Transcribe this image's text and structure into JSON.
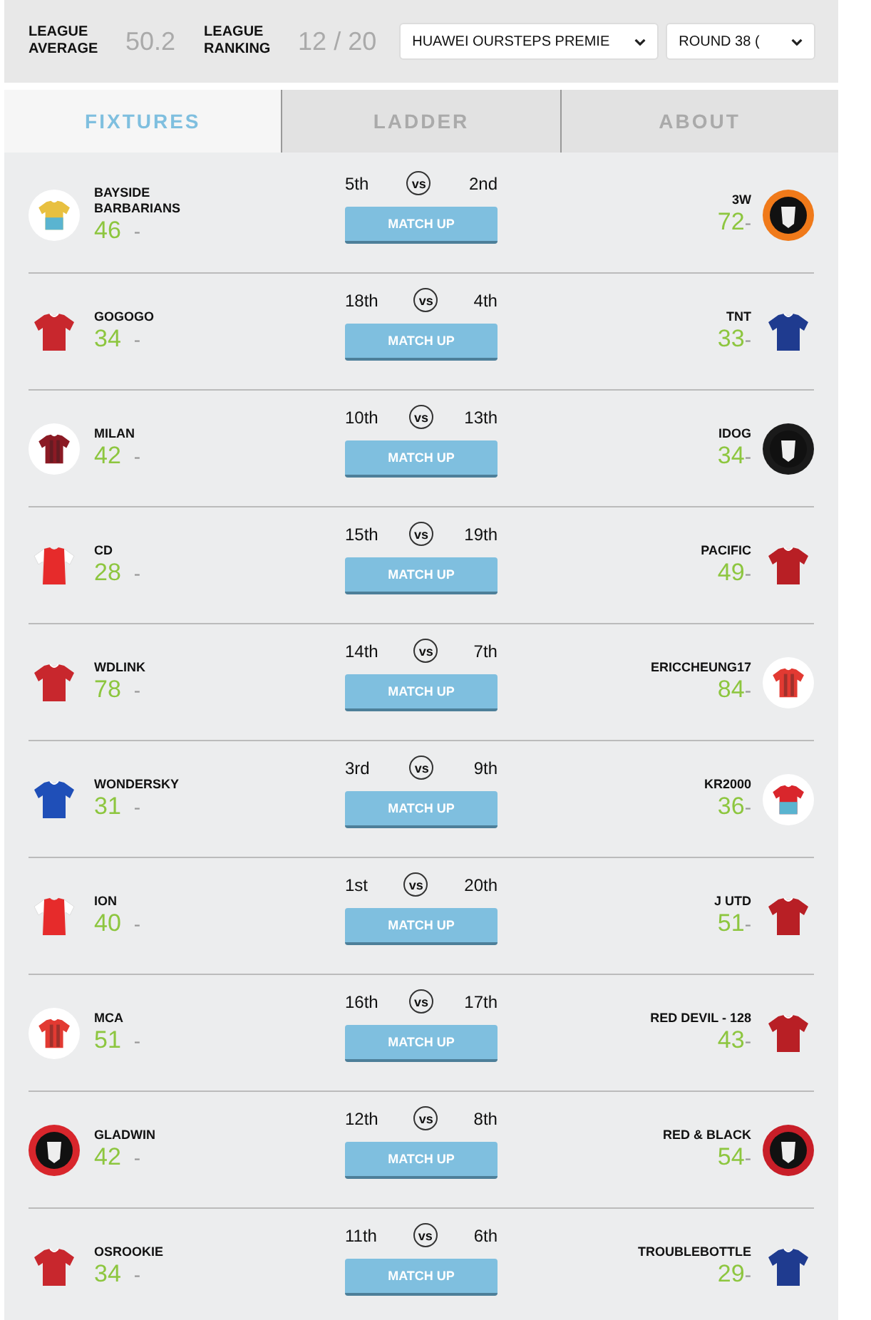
{
  "summary": [
    {
      "label": "LEAGUE AVERAGE",
      "value": "50.2"
    },
    {
      "label": "LEAGUE RANKING",
      "value": "12 / 20"
    }
  ],
  "selects": [
    {
      "value": "HUAWEI OURSTEPS PREMIE"
    },
    {
      "value": "ROUND 38 ("
    }
  ],
  "tabs": [
    {
      "label": "FIXTURES",
      "selected": true
    },
    {
      "label": "LADDER",
      "selected": false
    },
    {
      "label": "ABOUT",
      "selected": false
    }
  ],
  "fixtures": [
    {
      "home": {
        "name": "BAYSIDE BARBARIANS",
        "score": "46",
        "dash": "-",
        "rank": "5th",
        "avatar": {
          "kind": "striped",
          "color": "#e8c040"
        }
      },
      "away": {
        "name": "3W",
        "score": "72",
        "dash": "-",
        "rank": "2nd",
        "avatar": {
          "kind": "badge",
          "color": "#f07a1a"
        }
      },
      "vs": "vs",
      "button": "MATCH UP"
    },
    {
      "home": {
        "name": "GOGOGO",
        "score": "34",
        "dash": "-",
        "rank": "18th",
        "avatar": {
          "kind": "shirt",
          "color": "#c8272d"
        }
      },
      "away": {
        "name": "TNT",
        "score": "33",
        "dash": "-",
        "rank": "4th",
        "avatar": {
          "kind": "shirt",
          "color": "#1f3b8f"
        }
      },
      "vs": "vs",
      "button": "MATCH UP"
    },
    {
      "home": {
        "name": "MILAN",
        "score": "42",
        "dash": "-",
        "rank": "10th",
        "avatar": {
          "kind": "framed",
          "color": "#8b1a24"
        }
      },
      "away": {
        "name": "IDOG",
        "score": "34",
        "dash": "-",
        "rank": "13th",
        "avatar": {
          "kind": "badge",
          "color": "#1a1a1a"
        }
      },
      "vs": "vs",
      "button": "MATCH UP"
    },
    {
      "home": {
        "name": "CD",
        "score": "28",
        "dash": "-",
        "rank": "15th",
        "avatar": {
          "kind": "sleeved",
          "color": "#e62b2b"
        }
      },
      "away": {
        "name": "PACIFIC",
        "score": "49",
        "dash": "-",
        "rank": "19th",
        "avatar": {
          "kind": "shirt",
          "color": "#b81f25"
        }
      },
      "vs": "vs",
      "button": "MATCH UP"
    },
    {
      "home": {
        "name": "WDLINK",
        "score": "78",
        "dash": "-",
        "rank": "14th",
        "avatar": {
          "kind": "shirt",
          "color": "#c8272d"
        }
      },
      "away": {
        "name": "ERICCHEUNG17",
        "score": "84",
        "dash": "-",
        "rank": "7th",
        "avatar": {
          "kind": "framed",
          "color": "#e23a32"
        }
      },
      "vs": "vs",
      "button": "MATCH UP"
    },
    {
      "home": {
        "name": "WONDERSKY",
        "score": "31",
        "dash": "-",
        "rank": "3rd",
        "avatar": {
          "kind": "shirt",
          "color": "#1f4fb8"
        }
      },
      "away": {
        "name": "KR2000",
        "score": "36",
        "dash": "-",
        "rank": "9th",
        "avatar": {
          "kind": "striped",
          "color": "#d9262c"
        }
      },
      "vs": "vs",
      "button": "MATCH UP"
    },
    {
      "home": {
        "name": "ION",
        "score": "40",
        "dash": "-",
        "rank": "1st",
        "avatar": {
          "kind": "sleeved",
          "color": "#e62b2b"
        }
      },
      "away": {
        "name": "J UTD",
        "score": "51",
        "dash": "-",
        "rank": "20th",
        "avatar": {
          "kind": "shirt",
          "color": "#b81f25"
        }
      },
      "vs": "vs",
      "button": "MATCH UP"
    },
    {
      "home": {
        "name": "MCA",
        "score": "51",
        "dash": "-",
        "rank": "16th",
        "avatar": {
          "kind": "framed",
          "color": "#e23a32"
        }
      },
      "away": {
        "name": "RED DEVIL - 128",
        "score": "43",
        "dash": "-",
        "rank": "17th",
        "avatar": {
          "kind": "shirt",
          "color": "#b81f25"
        }
      },
      "vs": "vs",
      "button": "MATCH UP"
    },
    {
      "home": {
        "name": "GLADWIN",
        "score": "42",
        "dash": "-",
        "rank": "12th",
        "avatar": {
          "kind": "badge",
          "color": "#d8262c"
        }
      },
      "away": {
        "name": "RED & BLACK",
        "score": "54",
        "dash": "-",
        "rank": "8th",
        "avatar": {
          "kind": "badge",
          "color": "#c81e28"
        }
      },
      "vs": "vs",
      "button": "MATCH UP"
    },
    {
      "home": {
        "name": "OSROOKIE",
        "score": "34",
        "dash": "-",
        "rank": "11th",
        "avatar": {
          "kind": "shirt",
          "color": "#c8272d"
        }
      },
      "away": {
        "name": "TROUBLEBOTTLE",
        "score": "29",
        "dash": "-",
        "rank": "6th",
        "avatar": {
          "kind": "shirt",
          "color": "#1f3b8f"
        }
      },
      "vs": "vs",
      "button": "MATCH UP"
    }
  ]
}
